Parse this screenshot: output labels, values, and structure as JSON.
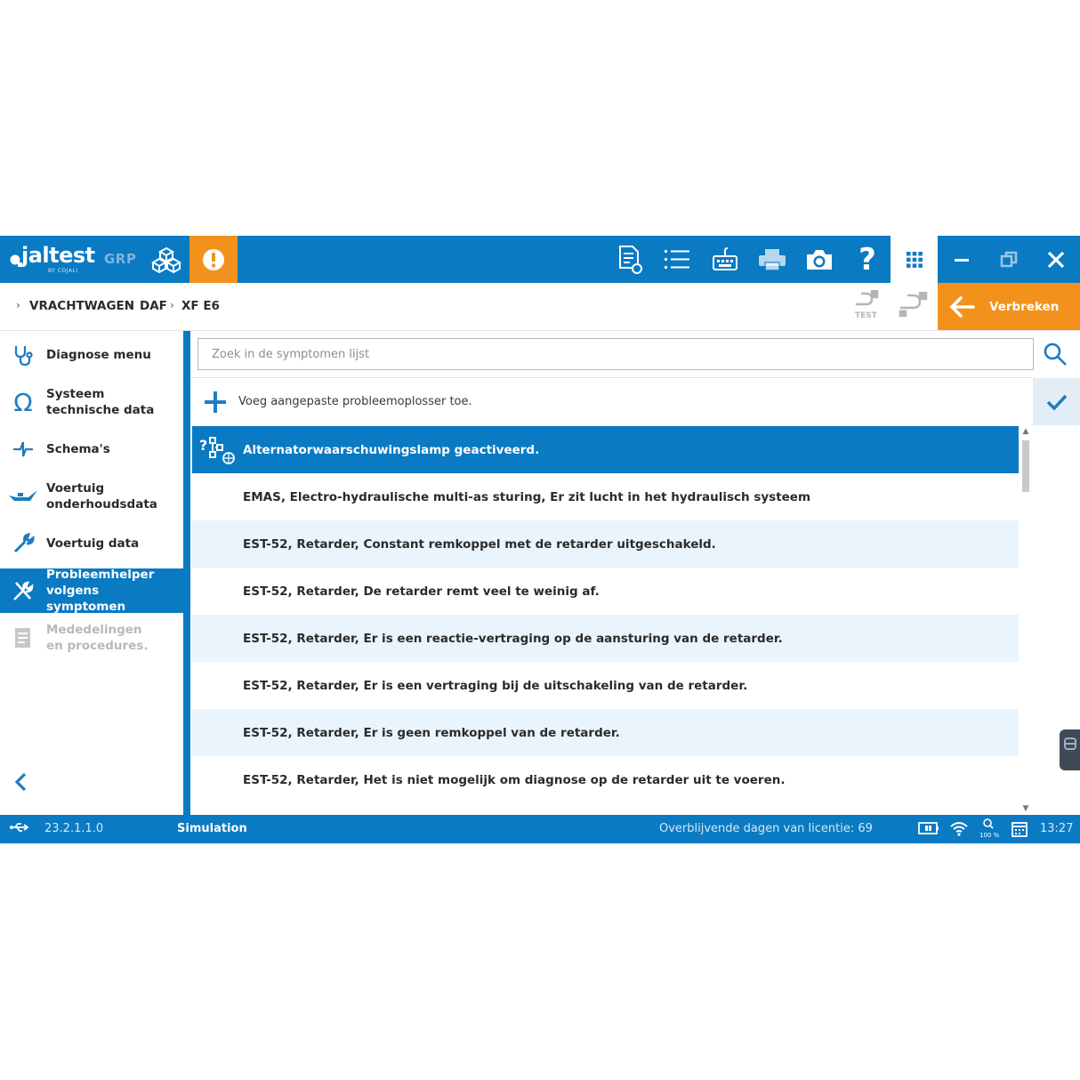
{
  "app": {
    "logo_text": "jaltest",
    "logo_sub": "BY COJALI",
    "mode_badge": "GRP"
  },
  "toolbar": {
    "icons": [
      "report-icon",
      "list-icon",
      "keyboard-icon",
      "printer-icon",
      "camera-icon",
      "help-icon",
      "apps-grid-icon"
    ],
    "alert_icon": "exclamation-icon"
  },
  "window": {
    "minimize": "minimize-icon",
    "restore": "restore-icon",
    "close": "close-icon"
  },
  "breadcrumb": [
    "VRACHTWAGEN",
    "DAF",
    "XF E6"
  ],
  "connection": {
    "test_label": "TEST",
    "disconnect_label": "Verbreken"
  },
  "sidebar": {
    "items": [
      {
        "label": "Diagnose menu",
        "icon": "stethoscope-icon",
        "state": "normal"
      },
      {
        "label": "Systeem technische data",
        "icon": "omega-icon",
        "state": "normal"
      },
      {
        "label": "Schema's",
        "icon": "schematic-icon",
        "state": "normal"
      },
      {
        "label": "Voertuig onderhoudsdata",
        "icon": "oilcan-icon",
        "state": "normal"
      },
      {
        "label": "Voertuig data",
        "icon": "wrench-icon",
        "state": "normal"
      },
      {
        "label": "Probleemhelper volgens symptomen",
        "icon": "tools-icon",
        "state": "active"
      },
      {
        "label": "Mededelingen en procedures.",
        "icon": "document-icon",
        "state": "disabled"
      }
    ]
  },
  "search": {
    "placeholder": "Zoek in de symptomen lijst",
    "value": ""
  },
  "add_troubleshooter": "Voeg aangepaste probleemoplosser toe.",
  "symptoms": [
    "Alternatorwaarschuwingslamp geactiveerd.",
    "EMAS, Electro-hydraulische multi-as sturing, Er zit lucht in het hydraulisch systeem",
    "EST-52, Retarder, Constant remkoppel met de retarder uitgeschakeld.",
    "EST-52, Retarder, De retarder remt veel te weinig af.",
    "EST-52, Retarder, Er is een reactie-vertraging op de aansturing van de retarder.",
    "EST-52, Retarder, Er is een vertraging bij de uitschakeling van de retarder.",
    "EST-52, Retarder, Er is geen remkoppel van de retarder.",
    "EST-52, Retarder, Het is niet mogelijk om diagnose op de retarder uit te voeren."
  ],
  "selected_index": 0,
  "status": {
    "version": "23.2.1.1.0",
    "mode": "Simulation",
    "license": "Overblijvende dagen van licentie: 69",
    "zoom": "100 %",
    "time": "13:27"
  },
  "colors": {
    "primary": "#0a7ac3",
    "accent": "#f2921c",
    "row_alt": "#eaf4fc"
  }
}
